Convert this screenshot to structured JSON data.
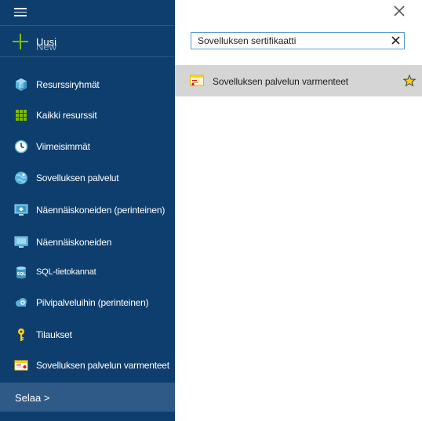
{
  "sidebar": {
    "menu_icon": "hamburger-menu-icon",
    "new_button": {
      "label": "Uusi",
      "ghost_label": "New",
      "icon": "plus-icon",
      "icon_color": "#7fba00"
    },
    "items": [
      {
        "label": "Resurssiryhmät",
        "icon": "resource-groups-icon"
      },
      {
        "label": "Kaikki resurssit",
        "icon": "all-resources-grid-icon"
      },
      {
        "label": "Viimeisimmät",
        "icon": "clock-icon"
      },
      {
        "label": "Sovelluksen palvelut",
        "icon": "app-services-globe-icon"
      },
      {
        "label": "Näennäiskoneiden (perinteinen)",
        "icon": "virtual-machine-classic-icon"
      },
      {
        "label": "Näennäiskoneiden",
        "icon": "virtual-machine-icon"
      },
      {
        "label": "SQL-tietokannat",
        "icon": "sql-database-icon"
      },
      {
        "label": "Pilvipalveluihin (perinteinen)",
        "icon": "cloud-services-icon"
      },
      {
        "label": "Tilaukset",
        "icon": "key-icon"
      },
      {
        "label": "Sovelluksen palvelun varmenteet",
        "icon": "certificate-icon"
      }
    ],
    "browse_label": "Selaa >",
    "background_color": "#0e3e6d",
    "browse_color": "#2f5a88"
  },
  "main": {
    "close_icon": "close-icon",
    "search": {
      "value": "Sovelluksen sertifikaatti",
      "clear_icon": "clear-icon"
    },
    "results": [
      {
        "label": "Sovelluksen palvelun varmenteet",
        "icon": "certificate-icon",
        "favorite_icon": "star-icon",
        "favorite_color": "#f8d117"
      }
    ],
    "highlight_color": "#d5d5d5"
  }
}
